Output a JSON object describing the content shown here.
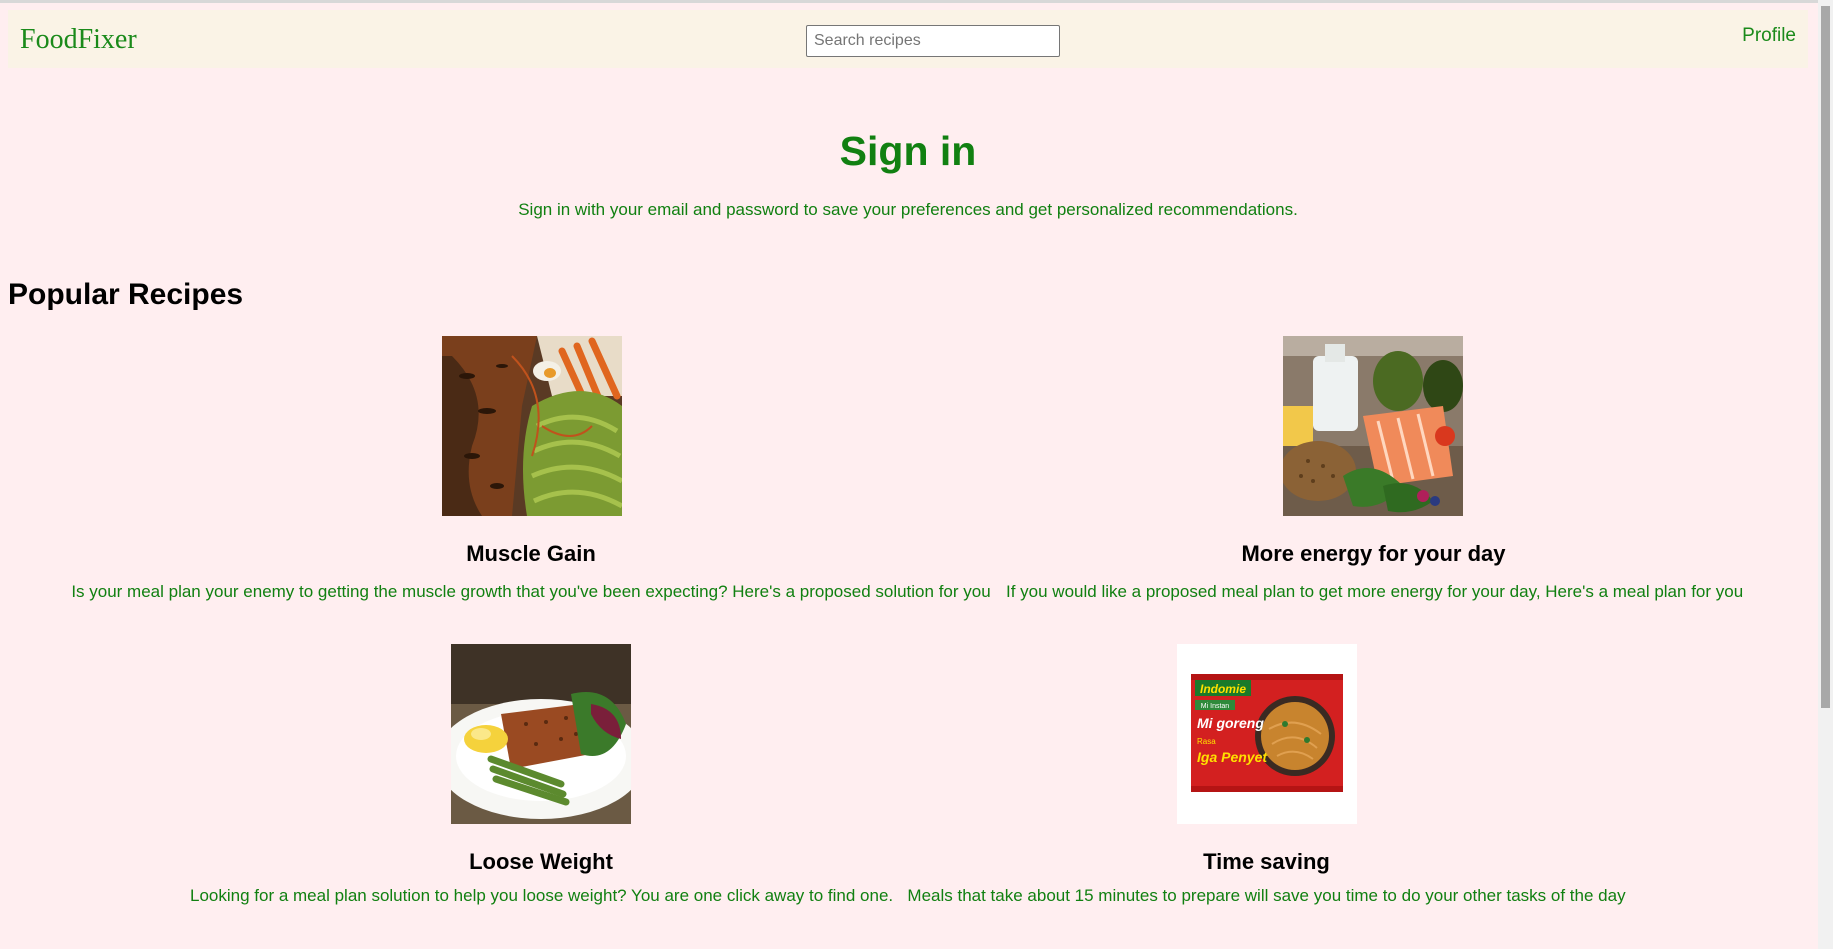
{
  "header": {
    "brand": "FoodFixer",
    "search_placeholder": "Search recipes",
    "profile_label": "Profile"
  },
  "signin": {
    "title": "Sign in",
    "description": "Sign in with your email and password to save your preferences and get personalized recommendations."
  },
  "popular": {
    "title": "Popular Recipes",
    "recipes": [
      {
        "title": "Muscle Gain",
        "description": "Is your meal plan your enemy to getting the muscle growth that you've been expecting? Here's a proposed solution for you",
        "image": "salmon-avocado-bowl"
      },
      {
        "title": "More energy for your day",
        "description": "If you would like a proposed meal plan to get more energy for your day, Here's a meal plan for you",
        "image": "milk-salmon-avocado-greens"
      },
      {
        "title": "Loose Weight",
        "description": "Looking for a meal plan solution to help you loose weight? You are one click away to find one.",
        "image": "salmon-asparagus-plate"
      },
      {
        "title": "Time saving",
        "description": "Meals that take about 15 minutes to prepare will save you time to do your other tasks of the day",
        "image": "instant-noodle-pack",
        "package_text": [
          "Indomie",
          "Mi Instan",
          "Mi goreng",
          "Rasa",
          "Iga Penyet"
        ]
      }
    ]
  }
}
